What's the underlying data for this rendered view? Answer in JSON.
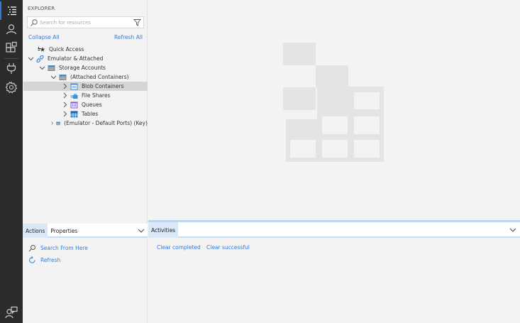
{
  "explorer": {
    "title": "EXPLORER",
    "search_placeholder": "Search for resources",
    "collapse_all": "Collapse All",
    "refresh_all": "Refresh All",
    "tree": [
      {
        "label": "Quick Access",
        "icon": "quick-access-icon",
        "expanded": null
      },
      {
        "label": "Emulator & Attached",
        "icon": "link-icon",
        "expanded": true
      },
      {
        "label": "Storage Accounts",
        "icon": "storage-account-icon",
        "expanded": true
      },
      {
        "label": "(Attached Containers)",
        "icon": "storage-account-icon",
        "expanded": true
      },
      {
        "label": "Blob Containers",
        "icon": "blob-container-icon",
        "expanded": false,
        "selected": true
      },
      {
        "label": "File Shares",
        "icon": "file-share-icon",
        "expanded": false
      },
      {
        "label": "Queues",
        "icon": "queue-icon",
        "expanded": false
      },
      {
        "label": "Tables",
        "icon": "table-icon",
        "expanded": false
      },
      {
        "label": "(Emulator - Default Ports) (Key)",
        "icon": "storage-account-icon",
        "expanded": false
      }
    ]
  },
  "bottom_left": {
    "tabs": [
      "Actions",
      "Properties"
    ],
    "actions": [
      {
        "label": "Search From Here",
        "icon": "search-icon"
      },
      {
        "label": "Refresh",
        "icon": "refresh-icon"
      }
    ]
  },
  "bottom_right": {
    "tab": "Activities",
    "clear_completed": "Clear completed",
    "clear_successful": "Clear successful"
  },
  "colors": {
    "accent": "#3a7bd5",
    "activity_bar": "#2b2b2b",
    "selected_row": "#d5d5d5"
  }
}
